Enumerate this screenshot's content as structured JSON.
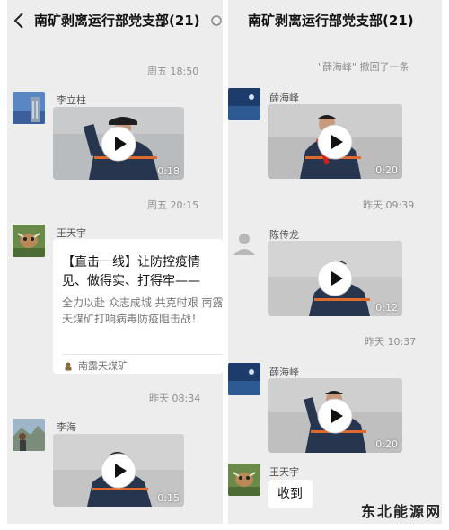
{
  "left_chat": {
    "title": "南矿剥离运行部党支部(21)",
    "messages": [
      {
        "kind": "timestamp",
        "text": "周五 18:50"
      },
      {
        "kind": "video",
        "sender": "李立柱",
        "duration": "0:18"
      },
      {
        "kind": "timestamp",
        "text": "周五 20:15"
      },
      {
        "kind": "link",
        "sender": "王天宇",
        "link_title": "【直击一线】让防控疫情见、做得实、打得牢——",
        "link_desc": "全力以赴 众志成城 共克时艰 南露天煤矿打响病毒防疫阻击战！",
        "link_source": "南露天煤矿"
      },
      {
        "kind": "timestamp",
        "text": "昨天 08:34"
      },
      {
        "kind": "video",
        "sender": "李海",
        "duration": "0:15"
      }
    ]
  },
  "right_chat": {
    "title": "南矿剥离运行部党支部(21)",
    "messages": [
      {
        "kind": "recall",
        "text": "\"薛海峰\" 撤回了一条"
      },
      {
        "kind": "video",
        "sender": "薛海峰",
        "duration": "0:20"
      },
      {
        "kind": "timestamp",
        "text": "昨天 09:39"
      },
      {
        "kind": "video",
        "sender": "陈传龙",
        "duration": "0:12"
      },
      {
        "kind": "timestamp",
        "text": "昨天 10:37"
      },
      {
        "kind": "video",
        "sender": "薛海峰",
        "duration": "0:20"
      },
      {
        "kind": "text",
        "sender": "王天宇",
        "text": "收到"
      }
    ]
  },
  "watermark": "东北能源网",
  "colors": {
    "chat_background": "#ededed",
    "bubble": "#ffffff",
    "timestamp_text": "#8f8f8f",
    "play_button": "#ffffff",
    "workwear_navy": "#27354f",
    "reflective_stripe": "#e06a2b"
  },
  "icons": {
    "back": "chevron-left-icon",
    "more": "more-icon",
    "play": "play-icon",
    "link_source": "source-logo-icon",
    "default_avatar": "default-avatar-icon"
  }
}
